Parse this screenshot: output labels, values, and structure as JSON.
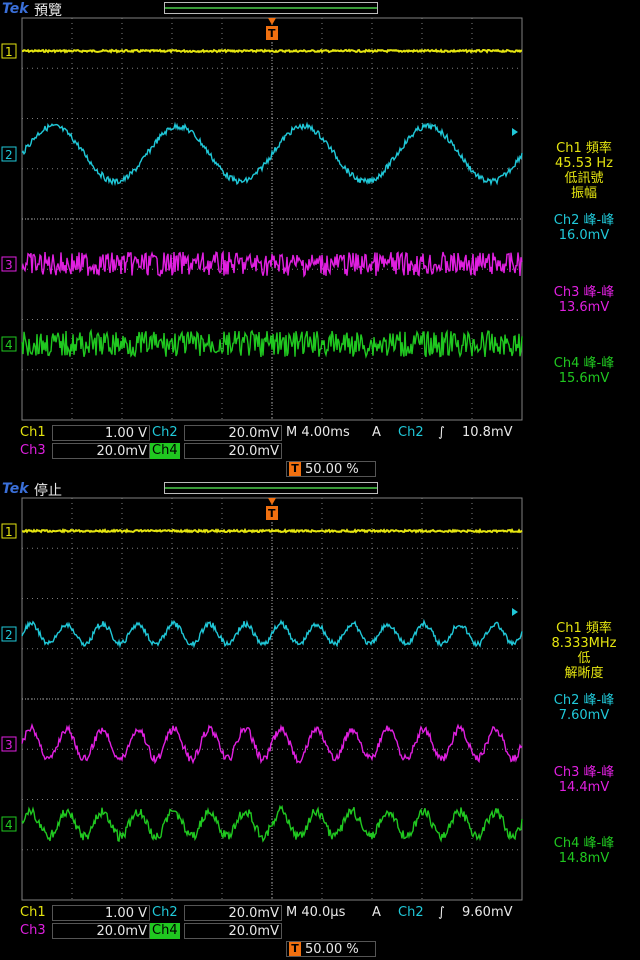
{
  "logo": "Tek",
  "colors": {
    "ch1": "#e5e510",
    "ch2": "#20c8d8",
    "ch3": "#e020e0",
    "ch4": "#20c820",
    "trigger": "#f07010",
    "grid": "#808080"
  },
  "top": {
    "state": "預覽",
    "measurements": {
      "ch1": [
        "Ch1 頻率",
        "45.53 Hz",
        "低訊號",
        "振幅"
      ],
      "ch2": [
        "Ch2 峰-峰",
        "16.0mV"
      ],
      "ch3": [
        "Ch3 峰-峰",
        "13.6mV"
      ],
      "ch4": [
        "Ch4 峰-峰",
        "15.6mV"
      ]
    },
    "status": {
      "ch1_label": "Ch1",
      "ch1_scale": "1.00 V",
      "ch2_label": "Ch2",
      "ch2_scale": "20.0mV",
      "ch3_label": "Ch3",
      "ch3_scale": "20.0mV",
      "ch4_label": "Ch4",
      "ch4_scale": "20.0mV",
      "timebase": "M 4.00ms",
      "acq": "A",
      "trig_source": "Ch2",
      "trig_level": "10.8mV",
      "trig_pos": "50.00 %"
    },
    "waves": {
      "ch2_periods": 4,
      "ch2_amp": 0.55,
      "ch3_periods": 0,
      "ch4_periods": 0
    }
  },
  "bottom": {
    "state": "停止",
    "measurements": {
      "ch1": [
        "Ch1 頻率",
        "8.333MHz",
        "低",
        "解晰度"
      ],
      "ch2": [
        "Ch2 峰-峰",
        "7.60mV"
      ],
      "ch3": [
        "Ch3 峰-峰",
        "14.4mV"
      ],
      "ch4": [
        "Ch4 峰-峰",
        "14.8mV"
      ]
    },
    "status": {
      "ch1_label": "Ch1",
      "ch1_scale": "1.00 V",
      "ch2_label": "Ch2",
      "ch2_scale": "20.0mV",
      "ch3_label": "Ch3",
      "ch3_scale": "20.0mV",
      "ch4_label": "Ch4",
      "ch4_scale": "20.0mV",
      "timebase": "M 40.0µs",
      "acq": "A",
      "trig_source": "Ch2",
      "trig_level": "9.60mV",
      "trig_pos": "50.00 %"
    },
    "waves": {
      "ch2_periods": 14,
      "ch2_amp": 0.2,
      "ch3_periods": 14,
      "ch4_periods": 14
    }
  },
  "markers": [
    "1",
    "2",
    "3",
    "4"
  ],
  "trigger_marker": "T"
}
